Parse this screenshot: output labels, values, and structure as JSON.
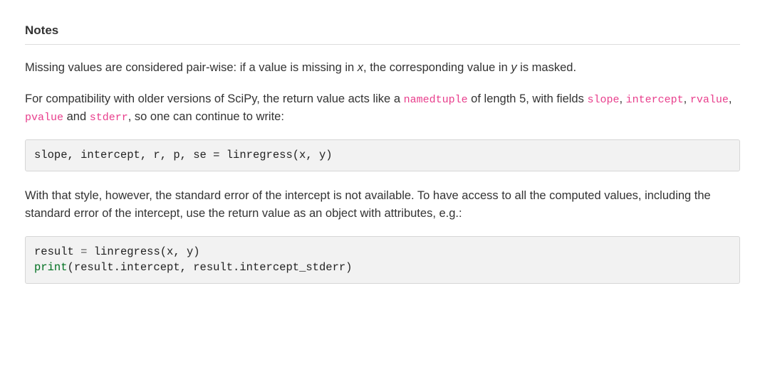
{
  "section": {
    "title": "Notes"
  },
  "paragraphs": {
    "p1_a": "Missing values are considered pair-wise: if a value is missing in ",
    "p1_var1": "x",
    "p1_b": ", the corresponding value in ",
    "p1_var2": "y",
    "p1_c": " is masked.",
    "p2_a": "For compatibility with older versions of SciPy, the return value acts like a ",
    "p2_code1": "namedtuple",
    "p2_b": " of length 5, with fields ",
    "p2_code2": "slope",
    "p2_sep1": ", ",
    "p2_code3": "intercept",
    "p2_sep2": ", ",
    "p2_code4": "rvalue",
    "p2_sep3": ", ",
    "p2_code5": "pvalue",
    "p2_sep4": " and ",
    "p2_code6": "stderr",
    "p2_c": ", so one can continue to write:",
    "p3": "With that style, however, the standard error of the intercept is not available. To have access to all the computed values, including the standard error of the intercept, use the return value as an object with attributes, e.g.:"
  },
  "code": {
    "block1": "slope, intercept, r, p, se = linregress(x, y)",
    "block2_line1_a": "result ",
    "block2_line1_op": "=",
    "block2_line1_b": " linregress(x, y)",
    "block2_line2_fn": "print",
    "block2_line2_rest": "(result.intercept, result.intercept_stderr)"
  }
}
